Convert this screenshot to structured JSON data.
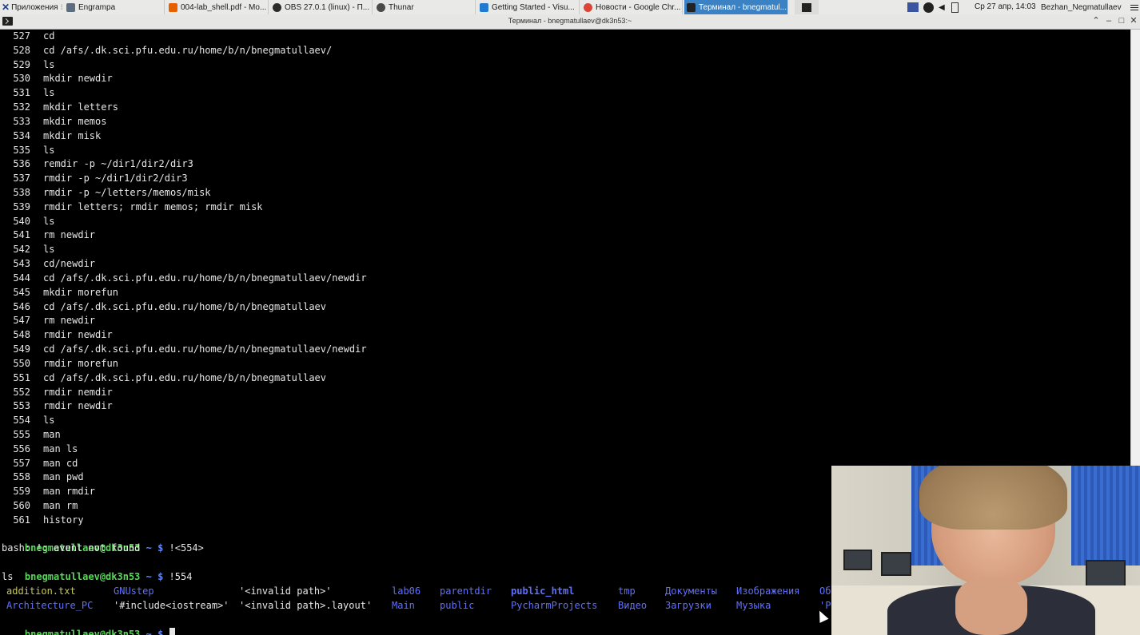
{
  "taskbar": {
    "apps_menu": "Приложения",
    "tasks": [
      {
        "label": "Engrampa",
        "color": "#5b6d7f"
      },
      {
        "label": "004-lab_shell.pdf - Mo...",
        "color": "#e66000"
      },
      {
        "label": "OBS 27.0.1 (linux) - П...",
        "color": "#2b2b2b"
      },
      {
        "label": "Thunar",
        "color": "#4a4a4a"
      },
      {
        "label": "Getting Started - Visu...",
        "color": "#1f7ad0"
      },
      {
        "label": "Новости - Google Chr...",
        "color": "#db4437"
      },
      {
        "label": "Терминал - bnegmatul...",
        "color": "#222222"
      }
    ],
    "clock": "Ср 27 апр, 14:03",
    "user": "Bezhan_Negmatullaev"
  },
  "window": {
    "title": "Терминал - bnegmatullaev@dk3n53:~",
    "minimize": "–",
    "maximize": "□",
    "close": "✕"
  },
  "terminal": {
    "history": [
      {
        "num": "527",
        "cmd": "cd"
      },
      {
        "num": "528",
        "cmd": "cd /afs/.dk.sci.pfu.edu.ru/home/b/n/bnegmatullaev/"
      },
      {
        "num": "529",
        "cmd": "ls"
      },
      {
        "num": "530",
        "cmd": "mkdir newdir"
      },
      {
        "num": "531",
        "cmd": "ls"
      },
      {
        "num": "532",
        "cmd": "mkdir letters"
      },
      {
        "num": "533",
        "cmd": "mkdir memos"
      },
      {
        "num": "534",
        "cmd": "mkdir misk"
      },
      {
        "num": "535",
        "cmd": "ls"
      },
      {
        "num": "536",
        "cmd": "remdir -p ~/dir1/dir2/dir3"
      },
      {
        "num": "537",
        "cmd": "rmdir -p ~/dir1/dir2/dir3"
      },
      {
        "num": "538",
        "cmd": "rmdir -p ~/letters/memos/misk"
      },
      {
        "num": "539",
        "cmd": "rmdir letters; rmdir memos; rmdir misk"
      },
      {
        "num": "540",
        "cmd": "ls"
      },
      {
        "num": "541",
        "cmd": "rm newdir"
      },
      {
        "num": "542",
        "cmd": "ls"
      },
      {
        "num": "543",
        "cmd": "cd/newdir"
      },
      {
        "num": "544",
        "cmd": "cd /afs/.dk.sci.pfu.edu.ru/home/b/n/bnegmatullaev/newdir"
      },
      {
        "num": "545",
        "cmd": "mkdir morefun"
      },
      {
        "num": "546",
        "cmd": "cd /afs/.dk.sci.pfu.edu.ru/home/b/n/bnegmatullaev"
      },
      {
        "num": "547",
        "cmd": "rm newdir"
      },
      {
        "num": "548",
        "cmd": "rmdir newdir"
      },
      {
        "num": "549",
        "cmd": "cd /afs/.dk.sci.pfu.edu.ru/home/b/n/bnegmatullaev/newdir"
      },
      {
        "num": "550",
        "cmd": "rmdir morefun"
      },
      {
        "num": "551",
        "cmd": "cd /afs/.dk.sci.pfu.edu.ru/home/b/n/bnegmatullaev"
      },
      {
        "num": "552",
        "cmd": "rmdir nemdir"
      },
      {
        "num": "553",
        "cmd": "rmdir newdir"
      },
      {
        "num": "554",
        "cmd": "ls"
      },
      {
        "num": "555",
        "cmd": "man"
      },
      {
        "num": "556",
        "cmd": "man ls"
      },
      {
        "num": "557",
        "cmd": "man cd"
      },
      {
        "num": "558",
        "cmd": "man pwd"
      },
      {
        "num": "559",
        "cmd": "man rmdir"
      },
      {
        "num": "560",
        "cmd": "man rm"
      },
      {
        "num": "561",
        "cmd": "history"
      }
    ],
    "prompt_user": "bnegmatullaev@dk3n53",
    "prompt_rest": " ~ $ ",
    "cmd1": "!<554>",
    "error": "bash: !: event not found",
    "cmd2": "!554",
    "echo": "ls",
    "ls_row1": [
      {
        "text": "addition.txt",
        "kind": "file"
      },
      {
        "text": "GNUstep",
        "kind": "dir"
      },
      {
        "text": "'<invalid path>'",
        "kind": "quote"
      },
      {
        "text": "lab06",
        "kind": "dir"
      },
      {
        "text": "parentdir",
        "kind": "dir"
      },
      {
        "text": "public_html",
        "kind": "dir-bold"
      },
      {
        "text": "tmp",
        "kind": "dir"
      },
      {
        "text": "Документы",
        "kind": "dir"
      },
      {
        "text": "Изображения",
        "kind": "dir"
      },
      {
        "text": "Об",
        "kind": "dir"
      }
    ],
    "ls_row2": [
      {
        "text": "Architecture_PC",
        "kind": "dir"
      },
      {
        "text": "'#include<iostream>'",
        "kind": "quote"
      },
      {
        "text": "'<invalid path>.layout'",
        "kind": "quote"
      },
      {
        "text": "Main",
        "kind": "dir"
      },
      {
        "text": "public",
        "kind": "dir"
      },
      {
        "text": "PycharmProjects",
        "kind": "dir"
      },
      {
        "text": "Видео",
        "kind": "dir"
      },
      {
        "text": "Загрузки",
        "kind": "dir"
      },
      {
        "text": "Музыка",
        "kind": "dir"
      },
      {
        "text": "'Ра",
        "kind": "dir"
      }
    ]
  }
}
